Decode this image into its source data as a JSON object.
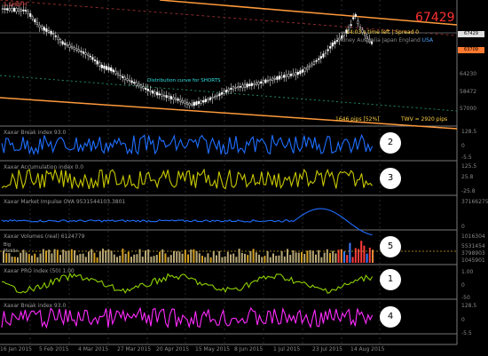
{
  "main_chart": {
    "symbol": "5 SHBFH",
    "big_price": "67429",
    "time_left": "14:03 s time left | Spread 0",
    "sessions": [
      "Sidney",
      "Australia",
      "Japan",
      "England",
      "USA"
    ],
    "distribution_label": "Distribution curve for SHORTS",
    "pips_label": "1646 pips   [52%]",
    "twv_label": "TWV = 2920 pips",
    "price_tags": [
      "67429",
      "63709"
    ],
    "axis_labels": [
      "64230",
      "58472",
      "57000"
    ]
  },
  "panels": [
    {
      "title": "Xaxar Break index  93.0",
      "badge": "2",
      "color": "#1f6fff",
      "axis": [
        "128.5",
        "0",
        "-5.5"
      ]
    },
    {
      "title": "Xaxar Accumulation index  0.0",
      "badge": "3",
      "color": "#c8c800",
      "axis": [
        "125.5",
        "25.8",
        "-25.8"
      ]
    },
    {
      "title": "Xaxar Market Impulse OVA  9531544103.3801",
      "badge": "",
      "color": "#1f6fff",
      "axis": [
        "37166275",
        "0"
      ]
    },
    {
      "title": "Xaxar Volumes (real) 6124779",
      "badge": "5",
      "color": "#ff3b3b",
      "axis": [
        "1016304",
        "5531454",
        "3798903",
        "1045901"
      ]
    },
    {
      "title": "Xaxar PRO index (50) 1.00",
      "badge": "1",
      "color": "#8fd100",
      "axis": [
        "1.00",
        "0",
        "-50"
      ]
    },
    {
      "title": "Xaxar Break index  93.0",
      "badge": "4",
      "color": "#ff2bff",
      "axis": [
        "128.5",
        "0",
        "-5.5"
      ]
    }
  ],
  "volume_legend": [
    "Big",
    "Middle"
  ],
  "dates": [
    "16 Jan 2015",
    "5 Feb 2015",
    "4 Mar 2015",
    "27 Mar 2015",
    "20 Apr 2015",
    "15 May 2015",
    "8 Jun 2015",
    "1 Jul 2015",
    "23 Jul 2015",
    "14 Aug 2015"
  ],
  "colors": {
    "background": "#000000",
    "channel": "#ff9a3c",
    "candles": "#ffffff",
    "grid": "#2a2a2a"
  }
}
